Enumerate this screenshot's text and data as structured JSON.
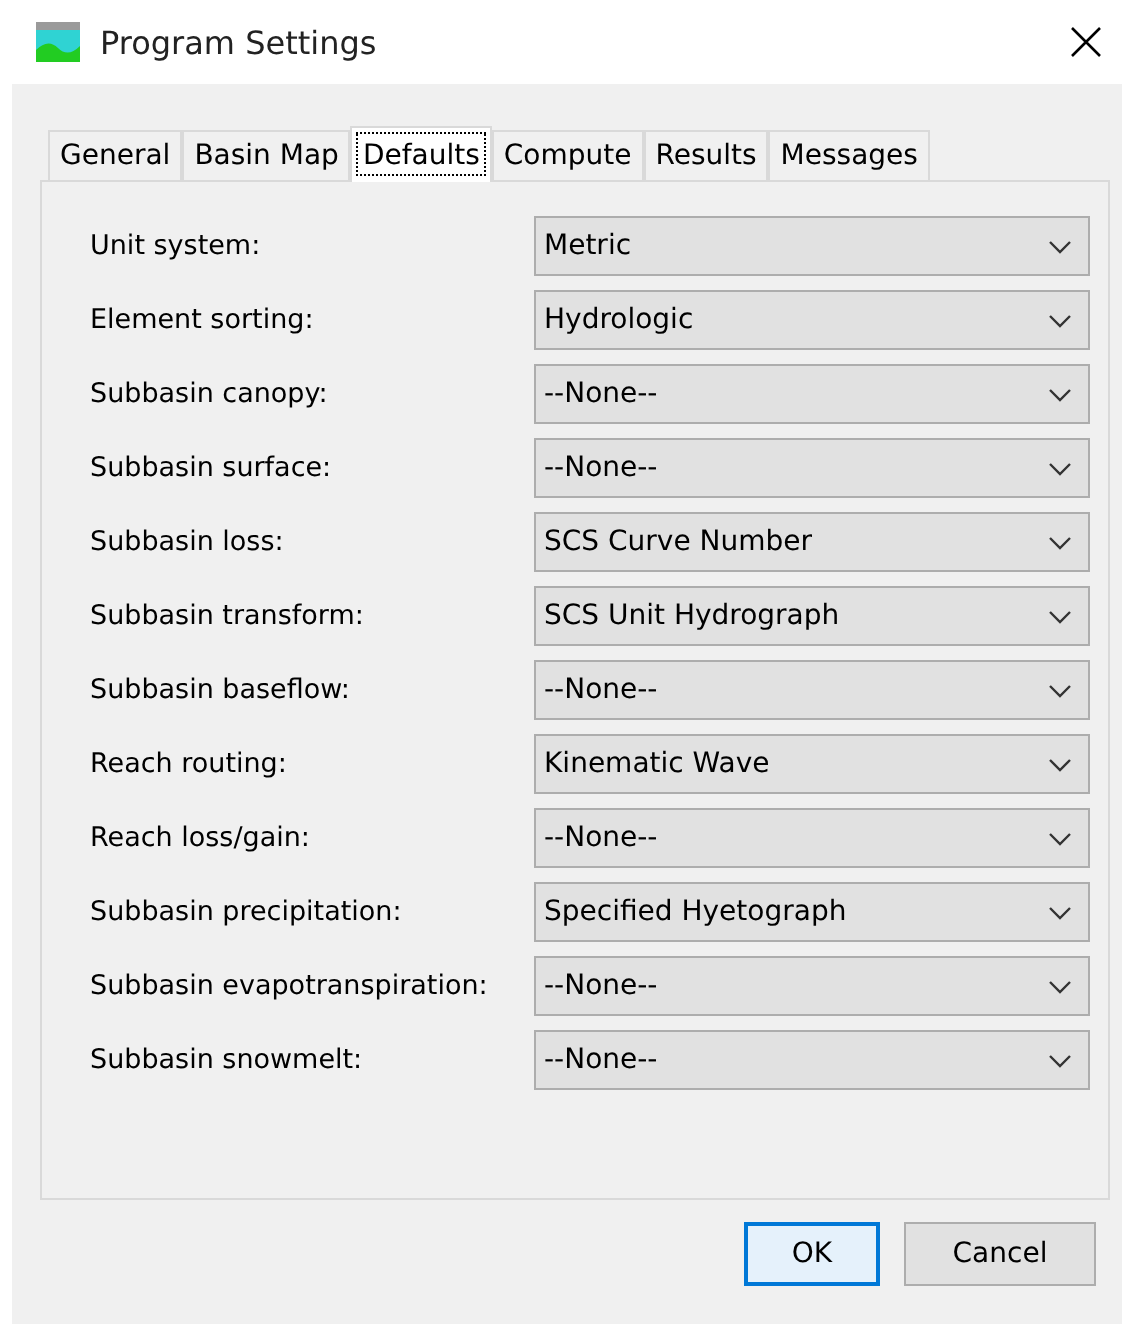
{
  "window": {
    "title": "Program Settings"
  },
  "tabs": [
    {
      "label": "General",
      "selected": false
    },
    {
      "label": "Basin Map",
      "selected": false
    },
    {
      "label": "Defaults",
      "selected": true
    },
    {
      "label": "Compute",
      "selected": false
    },
    {
      "label": "Results",
      "selected": false
    },
    {
      "label": "Messages",
      "selected": false
    }
  ],
  "settings": [
    {
      "label": "Unit system:",
      "value": "Metric"
    },
    {
      "label": "Element sorting:",
      "value": "Hydrologic"
    },
    {
      "label": "Subbasin canopy:",
      "value": "--None--"
    },
    {
      "label": "Subbasin surface:",
      "value": "--None--"
    },
    {
      "label": "Subbasin loss:",
      "value": "SCS Curve Number"
    },
    {
      "label": "Subbasin transform:",
      "value": "SCS Unit Hydrograph"
    },
    {
      "label": "Subbasin baseflow:",
      "value": "--None--"
    },
    {
      "label": "Reach routing:",
      "value": "Kinematic Wave"
    },
    {
      "label": "Reach loss/gain:",
      "value": "--None--"
    },
    {
      "label": "Subbasin precipitation:",
      "value": "Specified Hyetograph"
    },
    {
      "label": "Subbasin evapotranspiration:",
      "value": "--None--"
    },
    {
      "label": "Subbasin snowmelt:",
      "value": "--None--"
    }
  ],
  "buttons": [
    {
      "label": "OK",
      "default": true
    },
    {
      "label": "Cancel",
      "default": false
    }
  ]
}
